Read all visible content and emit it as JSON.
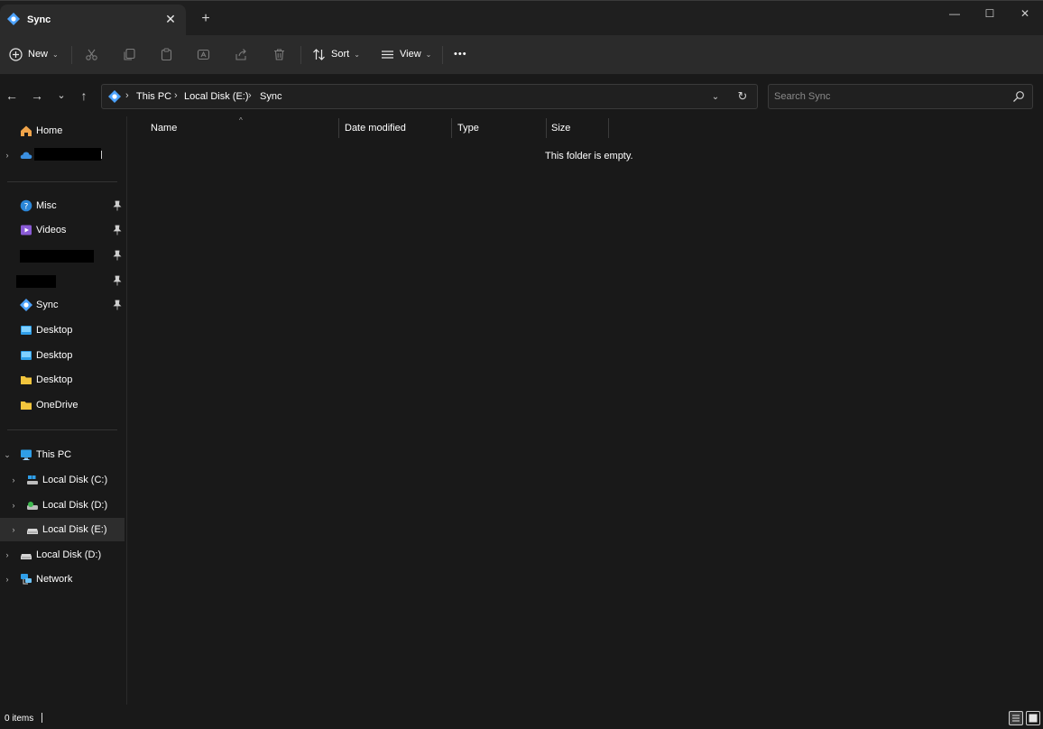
{
  "window": {
    "tab_title": "Sync",
    "tab_close": "✕",
    "new_tab": "+",
    "minimize": "—",
    "maximize": "☐",
    "close": "✕"
  },
  "toolbar": {
    "new_label": "New",
    "sort_label": "Sort",
    "view_label": "View",
    "more_label": "•••",
    "caret": "⌄"
  },
  "nav": {
    "back": "←",
    "forward": "→",
    "recent": "⌄",
    "up": "↑",
    "refresh": "↻",
    "dropdown": "⌄"
  },
  "address": {
    "crumbs": [
      "This PC",
      "Local Disk (E:)",
      "Sync"
    ],
    "sep": "›"
  },
  "search": {
    "placeholder": "Search Sync"
  },
  "sidebar": {
    "home": "Home",
    "quick": [
      "Misc",
      "Videos",
      "Sync",
      "Desktop",
      "Desktop",
      "Desktop",
      "OneDrive"
    ],
    "this_pc": "This PC",
    "drives": [
      "Local Disk (C:)",
      "Local Disk (D:)",
      "Local Disk (E:)"
    ],
    "local_disk_d2": "Local Disk (D:)",
    "network": "Network",
    "chev_right": "›",
    "chev_down": "⌄"
  },
  "columns": {
    "name": "Name",
    "date_modified": "Date modified",
    "type": "Type",
    "size": "Size",
    "sort_caret": "^"
  },
  "content": {
    "empty_message": "This folder is empty."
  },
  "status": {
    "items": "0 items"
  },
  "colors": {
    "accent_sync": "#4da3ff",
    "folder_yellow": "#f2c53d",
    "background": "#191919",
    "toolbar": "#2b2b2b"
  }
}
